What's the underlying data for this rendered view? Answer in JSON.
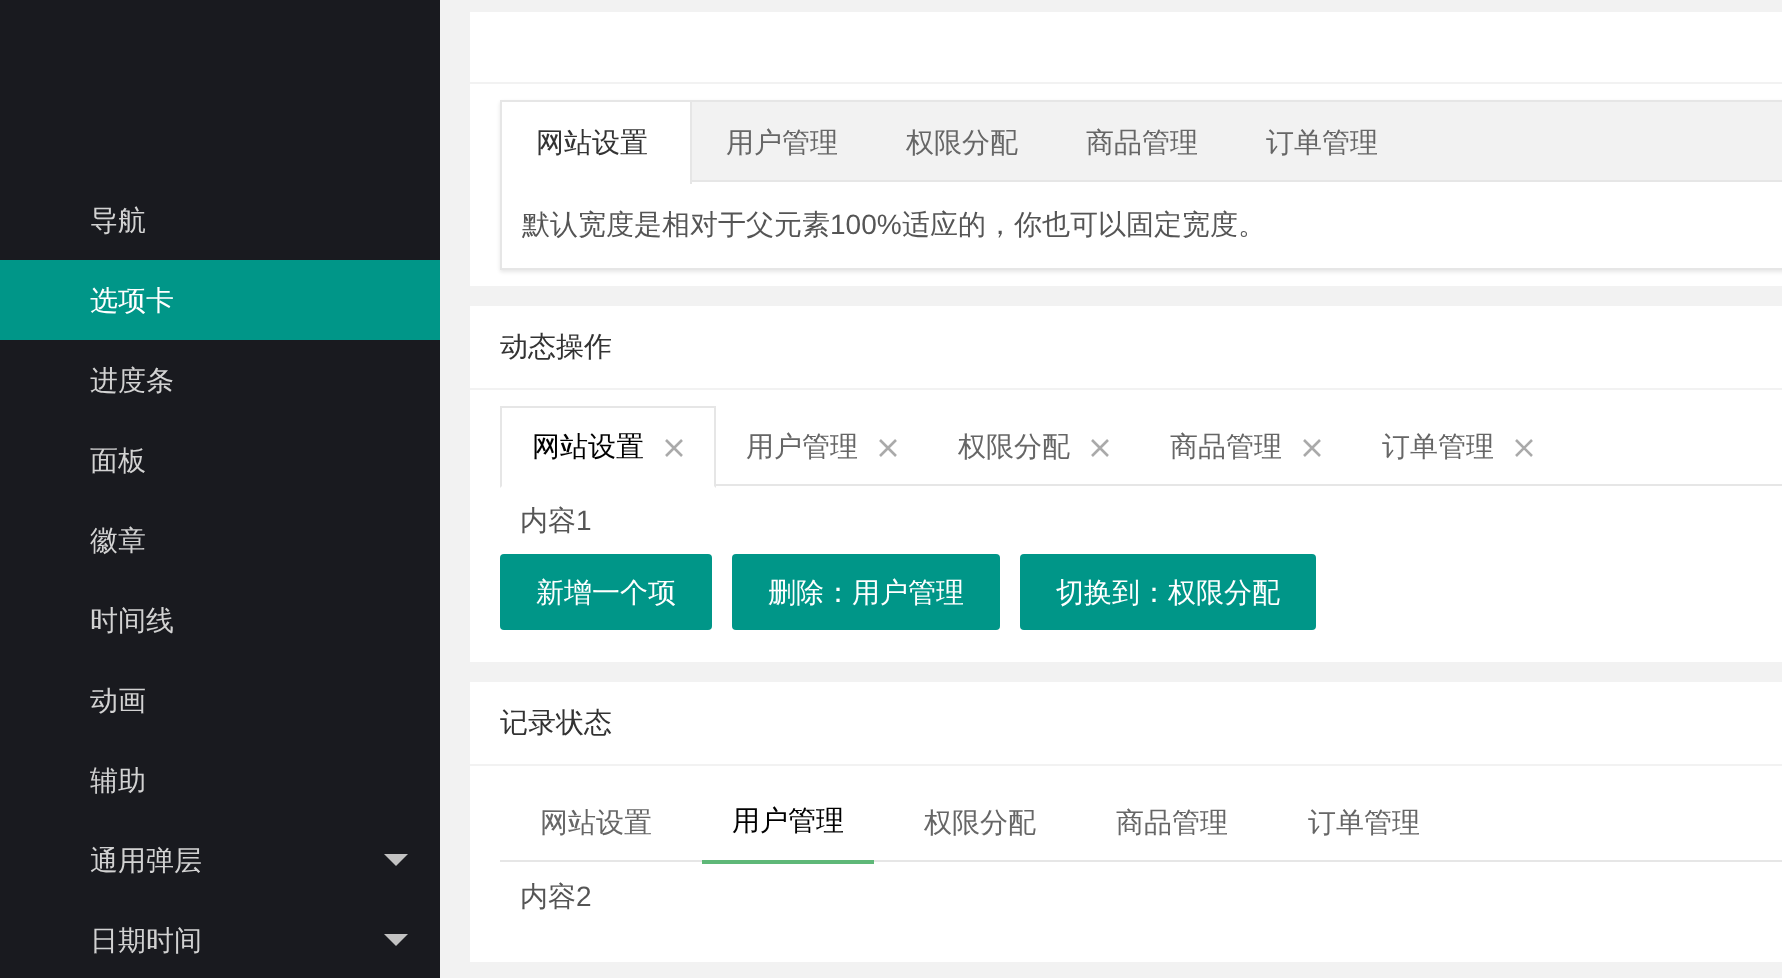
{
  "sidebar": {
    "items": [
      {
        "label": "导航",
        "selected": false,
        "expandable": false
      },
      {
        "label": "选项卡",
        "selected": true,
        "expandable": false
      },
      {
        "label": "进度条",
        "selected": false,
        "expandable": false
      },
      {
        "label": "面板",
        "selected": false,
        "expandable": false
      },
      {
        "label": "徽章",
        "selected": false,
        "expandable": false
      },
      {
        "label": "时间线",
        "selected": false,
        "expandable": false
      },
      {
        "label": "动画",
        "selected": false,
        "expandable": false
      },
      {
        "label": "辅助",
        "selected": false,
        "expandable": false
      },
      {
        "label": "通用弹层",
        "selected": false,
        "expandable": true
      },
      {
        "label": "日期时间",
        "selected": false,
        "expandable": true
      }
    ]
  },
  "sections": [
    {
      "kind": "card",
      "tabs": [
        {
          "label": "网站设置",
          "selected": true
        },
        {
          "label": "用户管理",
          "selected": false
        },
        {
          "label": "权限分配",
          "selected": false
        },
        {
          "label": "商品管理",
          "selected": false
        },
        {
          "label": "订单管理",
          "selected": false
        }
      ],
      "content": "默认宽度是相对于父元素100%适应的，你也可以固定宽度。"
    },
    {
      "kind": "closable",
      "title": "动态操作",
      "tabs": [
        {
          "label": "网站设置",
          "selected": true
        },
        {
          "label": "用户管理",
          "selected": false
        },
        {
          "label": "权限分配",
          "selected": false
        },
        {
          "label": "商品管理",
          "selected": false
        },
        {
          "label": "订单管理",
          "selected": false
        }
      ],
      "content": "内容1",
      "buttons": [
        "新增一个项",
        "删除：用户管理",
        "切换到：权限分配"
      ]
    },
    {
      "kind": "brief",
      "title": "记录状态",
      "tabs": [
        {
          "label": "网站设置",
          "selected": false
        },
        {
          "label": "用户管理",
          "selected": true
        },
        {
          "label": "权限分配",
          "selected": false
        },
        {
          "label": "商品管理",
          "selected": false
        },
        {
          "label": "订单管理",
          "selected": false
        }
      ],
      "content": "内容2"
    }
  ]
}
